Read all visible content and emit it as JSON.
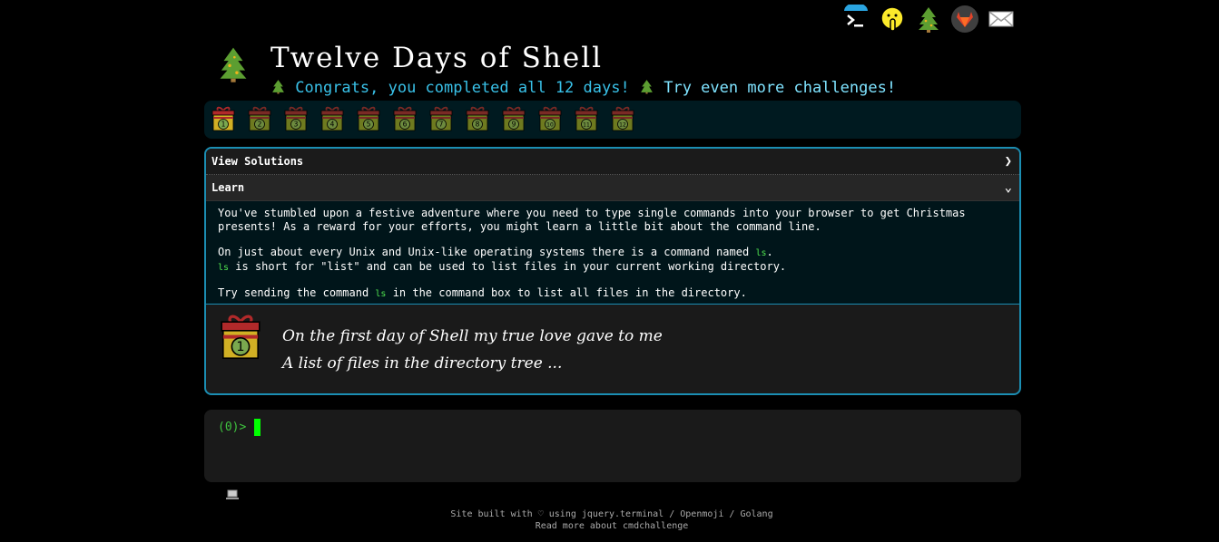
{
  "top_icons": [
    "terminal-icon",
    "shushing-face-icon",
    "christmas-tree-icon",
    "gitlab-icon",
    "envelope-icon"
  ],
  "header": {
    "title": "Twelve Days of Shell",
    "congrats": "Congrats, you completed all 12 days!",
    "more_link": "Try even more challenges!"
  },
  "gifts": [
    "1",
    "2",
    "3",
    "4",
    "5",
    "6",
    "7",
    "8",
    "9",
    "10",
    "11",
    "12"
  ],
  "panel": {
    "view_solutions": "View Solutions",
    "learn": "Learn",
    "para1": "You've stumbled upon a festive adventure where you need to type single commands into your browser to get Christmas presents! As a reward for your efforts, you might learn a little bit about the command line.",
    "para2_a": "On just about every Unix and Unix-like operating systems there is a command named",
    "para2_b": "is short for \"list\" and can be used to list files in your current working directory.",
    "para3_a": "Try sending the command",
    "para3_b": "in the command box to list all files in the directory.",
    "cmd": "ls",
    "dot": ".",
    "poem_line1": "On the first day of Shell my true love gave to me",
    "poem_line2": "A list of files in the directory tree ...",
    "gift_number": "1"
  },
  "terminal": {
    "prompt": "(0)>"
  },
  "footer": {
    "line1": "Site built with ♡ using jquery.terminal / Openmoji / Golang",
    "line2": "Read more about cmdchallenge"
  },
  "colors": {
    "accent": "#1b8eb3",
    "congrats": "#39c1e8",
    "command": "#4fe34f",
    "cursor": "#00ff00",
    "gift_gold": "#d1b024",
    "gift_red": "#b1292a"
  }
}
